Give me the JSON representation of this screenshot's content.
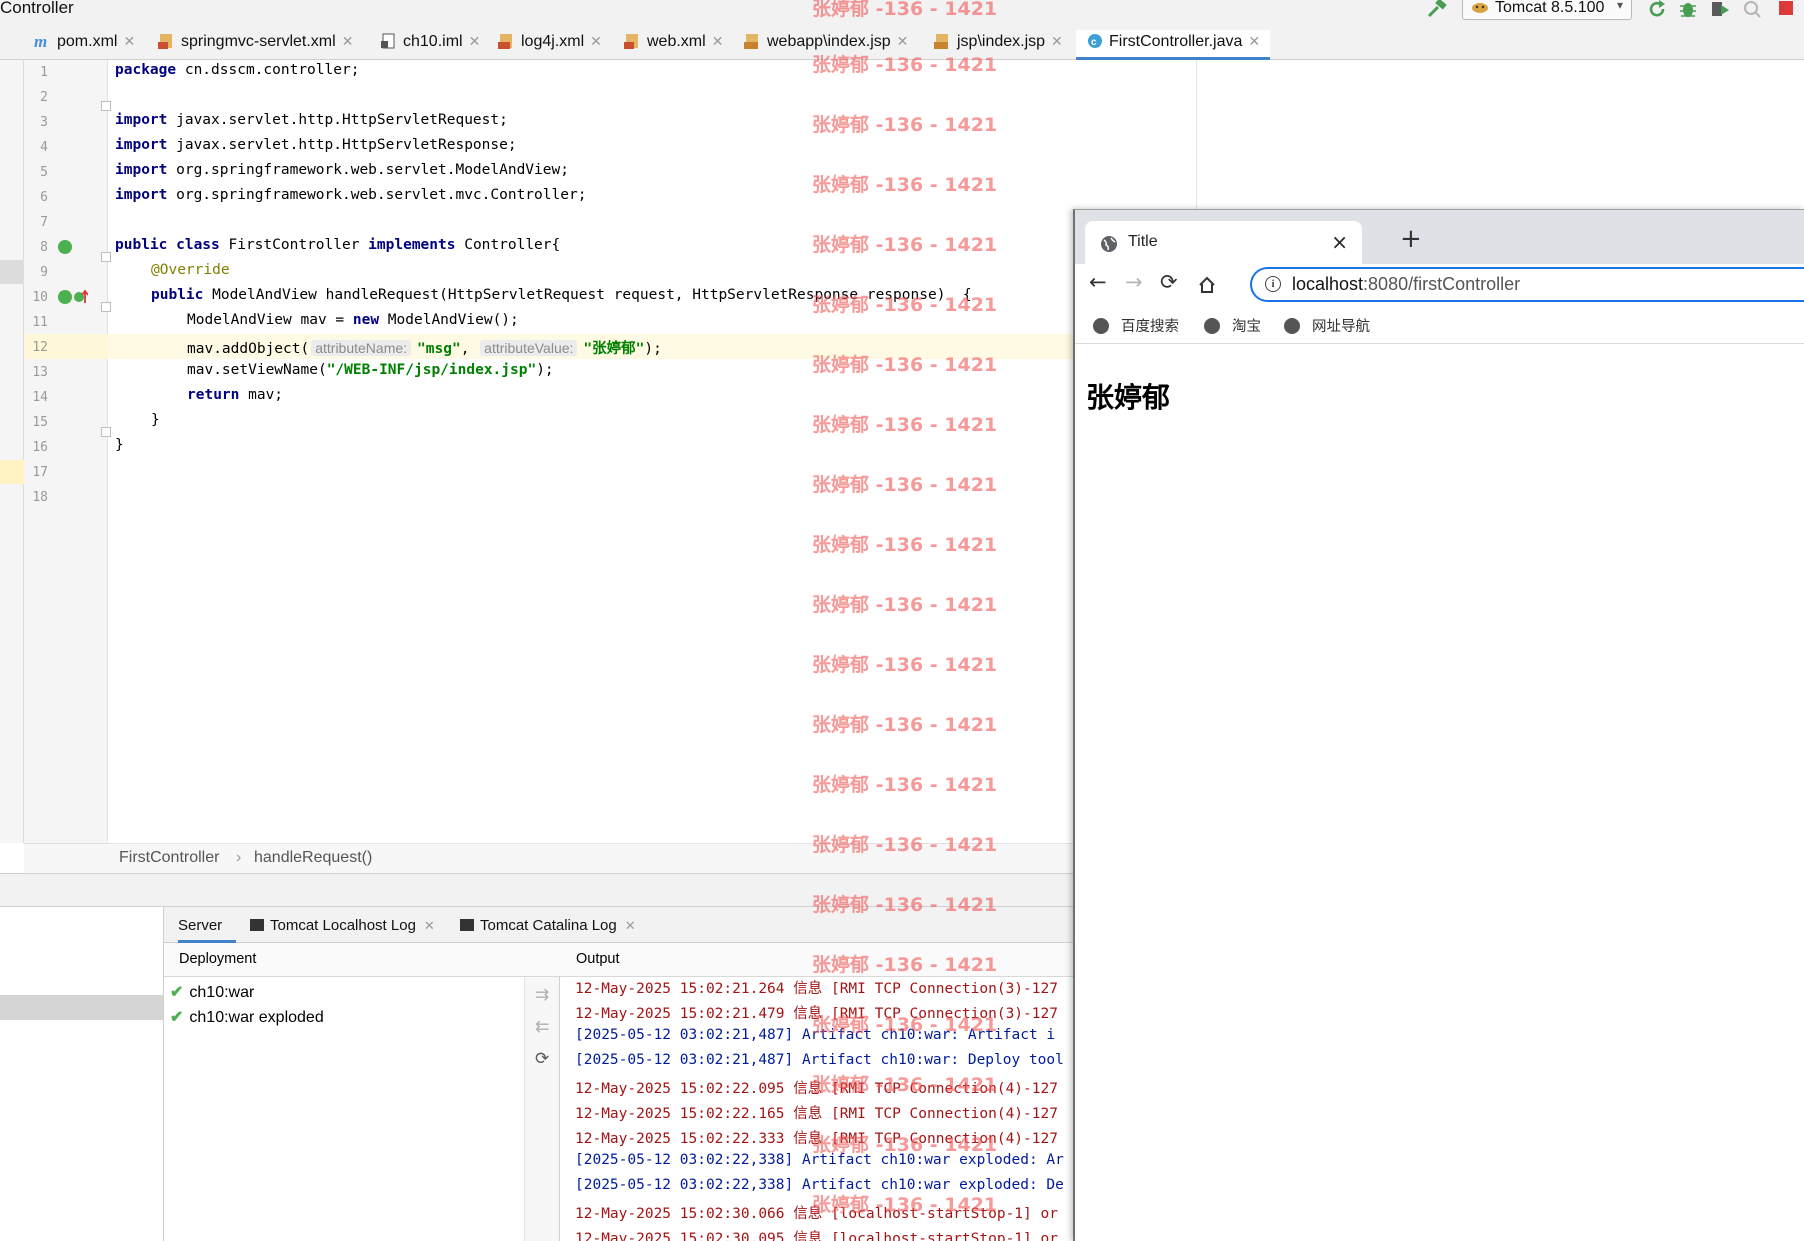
{
  "window": {
    "title_fragment": "Controller"
  },
  "run_config": {
    "label": "Tomcat 8.5.100"
  },
  "editor_tabs": [
    {
      "label": "pom.xml",
      "icon": "maven-icon"
    },
    {
      "label": "springmvc-servlet.xml",
      "icon": "spring-xml-icon"
    },
    {
      "label": "ch10.iml",
      "icon": "iml-file-icon"
    },
    {
      "label": "log4j.xml",
      "icon": "xml-file-icon"
    },
    {
      "label": "web.xml",
      "icon": "web-xml-icon"
    },
    {
      "label": "webapp\\index.jsp",
      "icon": "jsp-file-icon"
    },
    {
      "label": "jsp\\index.jsp",
      "icon": "jsp-file-icon"
    },
    {
      "label": "FirstController.java",
      "icon": "java-class-icon",
      "active": true
    }
  ],
  "code": {
    "line_numbers": [
      "1",
      "2",
      "3",
      "4",
      "5",
      "6",
      "7",
      "8",
      "9",
      "10",
      "11",
      "12",
      "13",
      "14",
      "15",
      "16",
      "17",
      "18"
    ],
    "l1": {
      "kw": "package",
      "rest": " cn.dsscm.controller;"
    },
    "l3": {
      "kw": "import",
      "rest": " javax.servlet.http.HttpServletRequest;"
    },
    "l4": {
      "kw": "import",
      "rest": " javax.servlet.http.HttpServletResponse;"
    },
    "l5": {
      "kw": "import",
      "rest": " org.springframework.web.servlet.ModelAndView;"
    },
    "l6": {
      "kw": "import",
      "rest": " org.springframework.web.servlet.mvc.Controller;"
    },
    "l8": {
      "kw1": "public class",
      "name": " FirstController ",
      "kw2": "implements",
      "rest": " Controller{"
    },
    "l9": {
      "annotation": "@Override"
    },
    "l10": {
      "kw": "public",
      "rest": " ModelAndView handleRequest(HttpServletRequest request, HttpServletResponse response)  {"
    },
    "l11": {
      "pre": "ModelAndView mav = ",
      "kw": "new",
      "rest": " ModelAndView();"
    },
    "l12": {
      "pre": "mav.addObject(",
      "hint1": "attributeName:",
      "str1": "\"msg\"",
      "comma": ",",
      "hint2": "attributeValue:",
      "str2": "\"张婷郁\"",
      "post": ");"
    },
    "l13": {
      "pre": "mav.setViewName(",
      "str": "\"/WEB-INF/jsp/index.jsp\"",
      "post": ");"
    },
    "l14": {
      "kw": "return",
      "rest": " mav;"
    },
    "l15": "}",
    "l16": "}"
  },
  "breadcrumb": {
    "class_name": "FirstController",
    "separator": "›",
    "method": "handleRequest()"
  },
  "services": {
    "tabs": [
      "Server",
      "Tomcat Localhost Log",
      "Tomcat Catalina Log"
    ],
    "deployment_header": "Deployment",
    "output_header": "Output",
    "deployments": [
      "ch10:war",
      "ch10:war exploded"
    ],
    "output_lines": [
      {
        "text": "12-May-2025 15:02:21.264 信息 [RMI TCP Connection(3)-127",
        "color": "red"
      },
      {
        "text": "12-May-2025 15:02:21.479 信息 [RMI TCP Connection(3)-127",
        "color": "red"
      },
      {
        "text": "[2025-05-12 03:02:21,487] Artifact ch10:war: Artifact i",
        "color": "blue"
      },
      {
        "text": "[2025-05-12 03:02:21,487] Artifact ch10:war: Deploy tool",
        "color": "blue"
      },
      {
        "text": "12-May-2025 15:02:22.095 信息 [RMI TCP Connection(4)-127",
        "color": "red"
      },
      {
        "text": "12-May-2025 15:02:22.165 信息 [RMI TCP Connection(4)-127",
        "color": "red"
      },
      {
        "text": "12-May-2025 15:02:22.333 信息 [RMI TCP Connection(4)-127",
        "color": "red"
      },
      {
        "text": "[2025-05-12 03:02:22,338] Artifact ch10:war exploded: Ar",
        "color": "blue"
      },
      {
        "text": "[2025-05-12 03:02:22,338] Artifact ch10:war exploded: De",
        "color": "blue"
      },
      {
        "text": "12-May-2025 15:02:30.066 信息 [localhost-startStop-1] or",
        "color": "red"
      },
      {
        "text": "12-May-2025 15:02:30.095 信息 [localhost-startStop-1] or",
        "color": "red"
      }
    ]
  },
  "browser": {
    "tab_title": "Title",
    "close_glyph": "×",
    "new_tab_glyph": "+",
    "url_host": "localhost",
    "url_path": ":8080/firstController",
    "bookmarks": [
      "百度搜索",
      "淘宝",
      "网址导航"
    ],
    "page_heading": "张婷郁"
  },
  "watermark": {
    "text": "张婷郁 -136 - 1421",
    "color": "#f05a5a"
  },
  "colors": {
    "keyword": "#000080",
    "string": "#008000",
    "annotation": "#808000",
    "log_red": "#a31515",
    "log_blue": "#001b9c",
    "accent": "#4083c9",
    "omnibox_focus": "#1a73e8"
  }
}
